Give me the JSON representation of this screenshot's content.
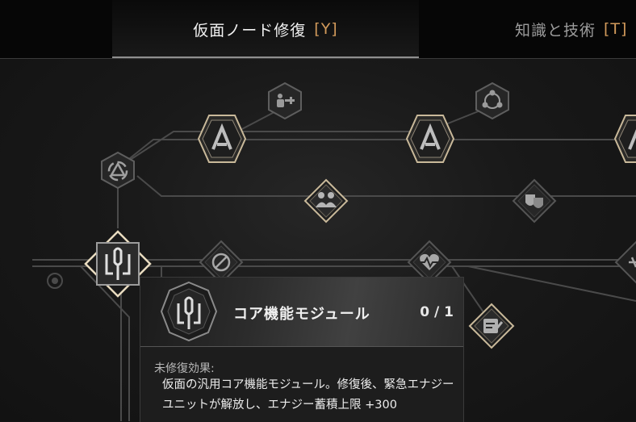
{
  "tabs": [
    {
      "label": "仮面ノード修復",
      "key": "[Y]",
      "active": true
    },
    {
      "label": "知識と技術",
      "key": "[T]",
      "active": false
    }
  ],
  "colors": {
    "accent": "#d29a5b",
    "node_gold": "#c9b99a",
    "line": "#4a4a4a"
  },
  "nodes": [
    {
      "name": "core-module",
      "icon": "mask-emblem-icon",
      "state": "selected"
    },
    {
      "name": "mask-a-left",
      "icon": "a-emblem-icon",
      "state": "large"
    },
    {
      "name": "mask-a-mid",
      "icon": "a-emblem-icon",
      "state": "large"
    },
    {
      "name": "mask-a-right",
      "icon": "a-emblem-icon",
      "state": "large"
    },
    {
      "name": "fitness",
      "icon": "weightlift-icon",
      "state": "locked"
    },
    {
      "name": "social",
      "icon": "community-icon",
      "state": "locked"
    },
    {
      "name": "recycle",
      "icon": "triangle-cycle-icon",
      "state": "locked"
    },
    {
      "name": "couple",
      "icon": "two-people-icon",
      "state": "available"
    },
    {
      "name": "drama",
      "icon": "theater-masks-icon",
      "state": "locked"
    },
    {
      "name": "no-sword",
      "icon": "crossed-sword-icon",
      "state": "locked"
    },
    {
      "name": "health",
      "icon": "heartbeat-icon",
      "state": "locked"
    },
    {
      "name": "notes",
      "icon": "notepad-icon",
      "state": "available"
    },
    {
      "name": "edge-right",
      "icon": "star-icon",
      "state": "locked"
    }
  ],
  "tooltip": {
    "title": "コア機能モジュール",
    "count": "0 / 1",
    "effect_label": "未修復効果:",
    "effect_text": "仮面の汎用コア機能モジュール。修復後、緊急エナジーユニットが解放し、エナジー蓄積上限 +300"
  }
}
